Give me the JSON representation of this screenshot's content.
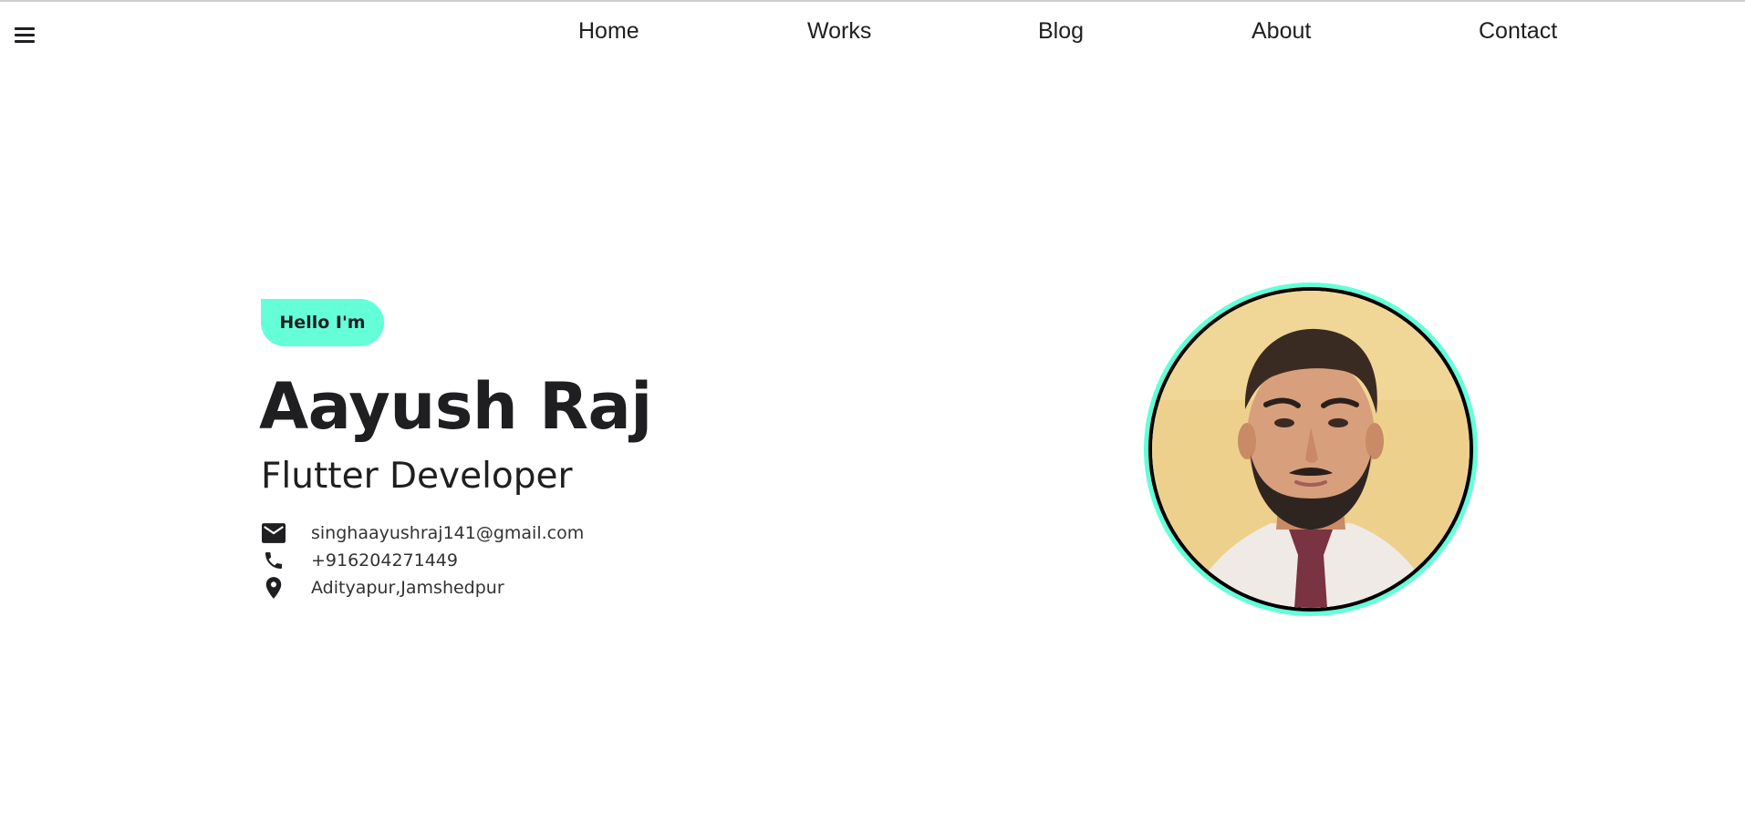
{
  "nav": {
    "menu_icon": "hamburger-menu-icon",
    "items": [
      {
        "label": "Home"
      },
      {
        "label": "Works"
      },
      {
        "label": "Blog"
      },
      {
        "label": "About"
      },
      {
        "label": "Contact"
      }
    ]
  },
  "hero": {
    "greeting": "Hello I'm",
    "name": "Aayush Raj",
    "role": "Flutter Developer",
    "contacts": [
      {
        "icon": "mail-icon",
        "text": "singhaayushraj141@gmail.com"
      },
      {
        "icon": "phone-icon",
        "text": "+916204271449"
      },
      {
        "icon": "location-pin-icon",
        "text": "Adityapur,Jamshedpur"
      }
    ]
  },
  "colors": {
    "accent": "#64ffd9",
    "text": "#1f1f22",
    "background": "#ffffff"
  }
}
